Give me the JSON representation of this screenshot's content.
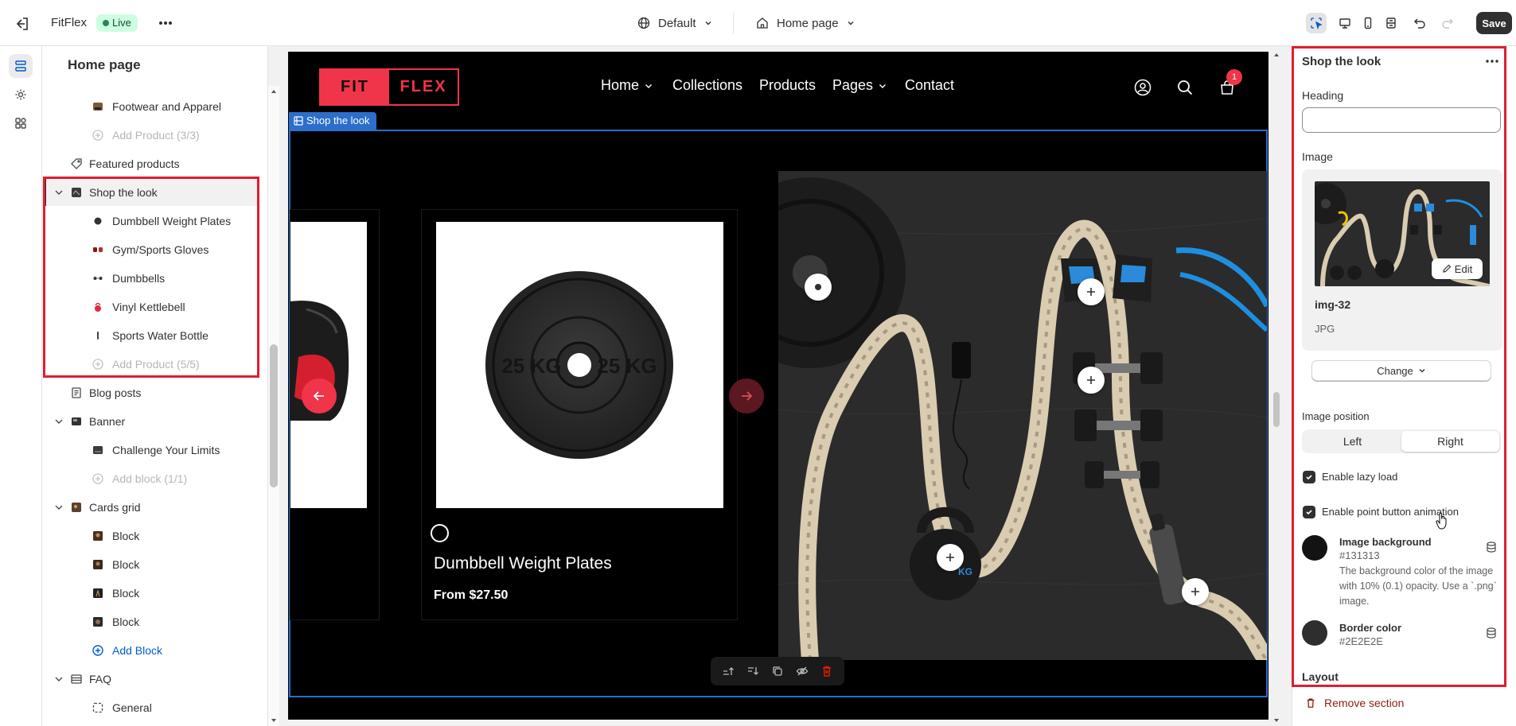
{
  "topbar": {
    "store_name": "FitFlex",
    "status_badge": "Live",
    "theme_dropdown": "Default",
    "page_dropdown": "Home page",
    "save_label": "Save"
  },
  "sidebar": {
    "title": "Home page",
    "items": [
      {
        "label": "Footwear and Apparel"
      },
      {
        "label": "Add Product (3/3)"
      },
      {
        "label": "Featured products"
      },
      {
        "label": "Shop the look"
      },
      {
        "label": "Dumbbell Weight Plates"
      },
      {
        "label": "Gym/Sports Gloves"
      },
      {
        "label": "Dumbbells"
      },
      {
        "label": "Vinyl Kettlebell"
      },
      {
        "label": "Sports Water Bottle"
      },
      {
        "label": "Add Product (5/5)"
      },
      {
        "label": "Blog posts"
      },
      {
        "label": "Banner"
      },
      {
        "label": "Challenge Your Limits"
      },
      {
        "label": "Add block (1/1)"
      },
      {
        "label": "Cards grid"
      },
      {
        "label": "Block"
      },
      {
        "label": "Block"
      },
      {
        "label": "Block"
      },
      {
        "label": "Block"
      },
      {
        "label": "Add Block"
      },
      {
        "label": "FAQ"
      },
      {
        "label": "General"
      }
    ]
  },
  "preview": {
    "logo_left": "FIT",
    "logo_right": "FLEX",
    "nav": [
      {
        "label": "Home"
      },
      {
        "label": "Collections"
      },
      {
        "label": "Products"
      },
      {
        "label": "Pages"
      },
      {
        "label": "Contact"
      }
    ],
    "cart_count": "1",
    "section_label": "Shop the look",
    "product_name": "Dumbbell Weight Plates",
    "product_price": "From $27.50",
    "plate_text": "25 KG"
  },
  "panel": {
    "title": "Shop the look",
    "heading_label": "Heading",
    "heading_value": "",
    "image_label": "Image",
    "image_name": "img-32",
    "image_type": "JPG",
    "edit_label": "Edit",
    "change_label": "Change",
    "image_position_label": "Image position",
    "position_options": [
      {
        "label": "Left"
      },
      {
        "label": "Right"
      }
    ],
    "position_selected": "Right",
    "lazy_load_label": "Enable lazy load",
    "lazy_load_checked": true,
    "animation_label": "Enable point button animation",
    "animation_checked": true,
    "image_bg_title": "Image background",
    "image_bg_value": "#131313",
    "image_bg_help": "The background color of the image with 10% (0.1) opacity. Use a `.png` image.",
    "border_title": "Border color",
    "border_value": "#2E2E2E",
    "layout_heading": "Layout",
    "remove_label": "Remove section"
  },
  "colors": {
    "brand_red": "#f03449",
    "selection_blue": "#2c6ecb",
    "annotation_red": "#e11d2f",
    "image_background": "#131313",
    "border_color": "#2E2E2E"
  }
}
